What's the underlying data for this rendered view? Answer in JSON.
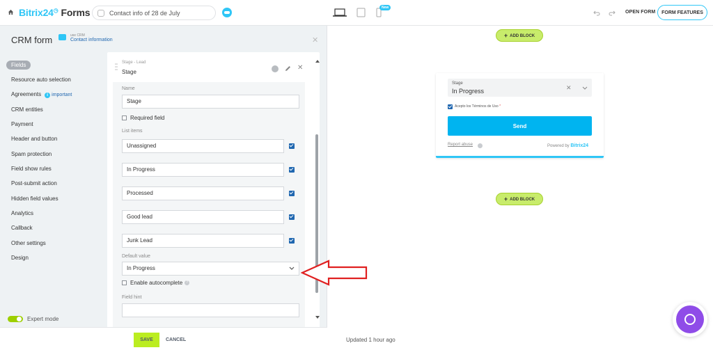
{
  "topbar": {
    "brand_name": "Bitrix24",
    "brand_suffix": "Forms",
    "form_title": "Contact info of 28 de July",
    "new_badge": "New",
    "open_form_label": "OPEN FORM",
    "features_label": "FORM FEATURES"
  },
  "panel": {
    "title": "CRM form",
    "subtitle_small": "use CRM",
    "subtitle_link": "Contact information"
  },
  "sidebar": {
    "items": [
      {
        "label": "Fields",
        "active": true
      },
      {
        "label": "Resource auto selection"
      },
      {
        "label": "Agreements",
        "badge": "important"
      },
      {
        "label": "CRM entities"
      },
      {
        "label": "Payment"
      },
      {
        "label": "Header and button"
      },
      {
        "label": "Spam protection"
      },
      {
        "label": "Field show rules"
      },
      {
        "label": "Post-submit action"
      },
      {
        "label": "Hidden field values"
      },
      {
        "label": "Analytics"
      },
      {
        "label": "Callback"
      },
      {
        "label": "Other settings"
      },
      {
        "label": "Design"
      }
    ],
    "expert_mode_label": "Expert mode"
  },
  "field_editor": {
    "header_small": "Stage - Lead",
    "header_name": "Stage",
    "name_label": "Name",
    "name_value": "Stage",
    "required_label": "Required field",
    "list_items_label": "List items",
    "list_items": [
      "Unassigned",
      "In Progress",
      "Processed",
      "Good lead",
      "Junk Lead"
    ],
    "default_value_label": "Default value",
    "default_value": "In Progress",
    "autocomplete_label": "Enable autocomplete",
    "field_hint_label": "Field hint"
  },
  "footer": {
    "save_label": "SAVE",
    "cancel_label": "CANCEL"
  },
  "preview": {
    "add_block_label": "ADD BLOCK",
    "select_label": "Stage",
    "select_value": "In Progress",
    "terms_label": "Acepto los Términos de Uso",
    "terms_required": "*",
    "send_label": "Send",
    "report_label": "Report abuse",
    "powered_label": "Powered by",
    "powered_brand": "Bitrix24",
    "updated_label": "Updated 1 hour ago"
  },
  "colors": {
    "accent": "#2fc6f6",
    "save": "#bbed21",
    "add_block": "#c8ec6b",
    "send": "#00b4f0",
    "arrow": "#e02020",
    "widget": "#8f4ce8"
  }
}
